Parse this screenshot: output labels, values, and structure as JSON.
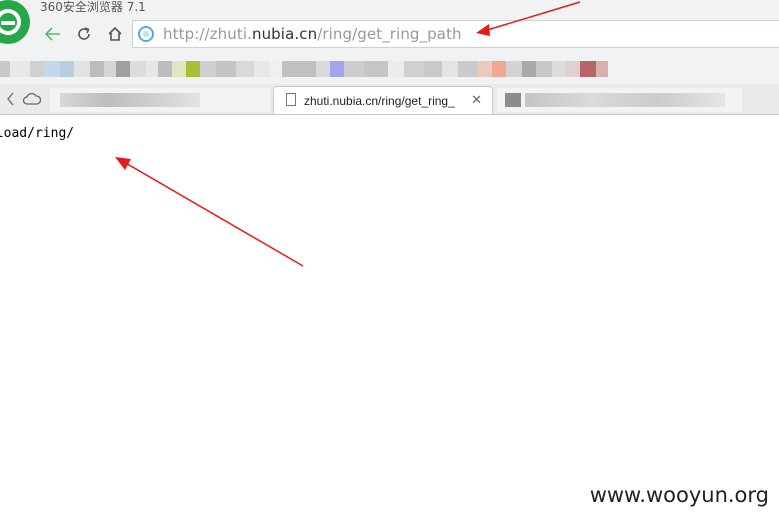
{
  "window": {
    "app_title": "360安全浏览器 7.1"
  },
  "toolbar": {
    "back_icon": "arrow-left-icon",
    "reload_icon": "reload-icon",
    "home_icon": "home-icon"
  },
  "address_bar": {
    "url_prefix": "http://zhuti.",
    "url_host": "nubia.cn",
    "url_path": "/ring/get_ring_path",
    "icon": "globe-icon"
  },
  "tabs": {
    "active_title": "zhuti.nubia.cn/ring/get_ring_",
    "close_glyph": "✕"
  },
  "page": {
    "body_text": "pload/ring/"
  },
  "watermark": "www.wooyun.org",
  "annotation_color": "#e8191b"
}
